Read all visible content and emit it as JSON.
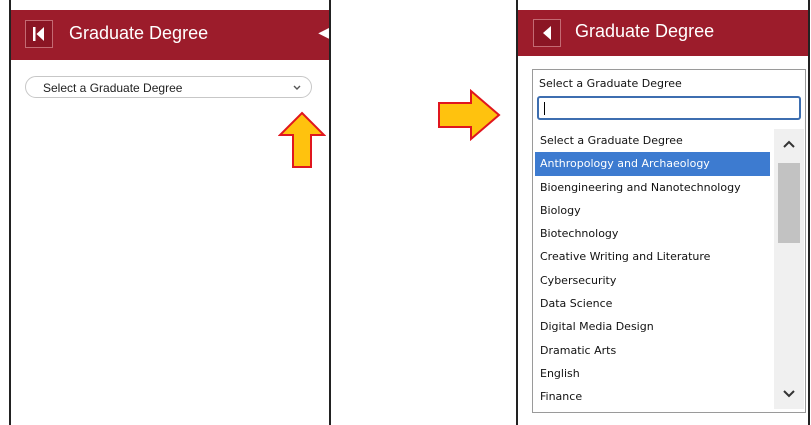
{
  "left_panel": {
    "header": {
      "title": "Graduate Degree"
    },
    "select": {
      "value": "Select a Graduate Degree"
    }
  },
  "right_panel": {
    "header": {
      "title": "Graduate Degree"
    },
    "dropdown": {
      "label": "Select a Graduate Degree",
      "search_value": "",
      "options": [
        "Select a Graduate Degree",
        "Anthropology and Archaeology",
        "Bioengineering and Nanotechnology",
        "Biology",
        "Biotechnology",
        "Creative Writing and Literature",
        "Cybersecurity",
        "Data Science",
        "Digital Media Design",
        "Dramatic Arts",
        "English",
        "Finance"
      ],
      "highlighted_option": "Anthropology and Archaeology"
    }
  },
  "colors": {
    "header_bg": "#9c1c2b",
    "highlight": "#3d7bd0",
    "arrow_fill": "#ffc20e",
    "arrow_stroke": "#e0161e"
  },
  "icons": [
    "back-icon",
    "chevron-down-icon",
    "up-arrow-icon",
    "right-arrow-icon",
    "scroll-up-icon",
    "scroll-down-icon"
  ]
}
